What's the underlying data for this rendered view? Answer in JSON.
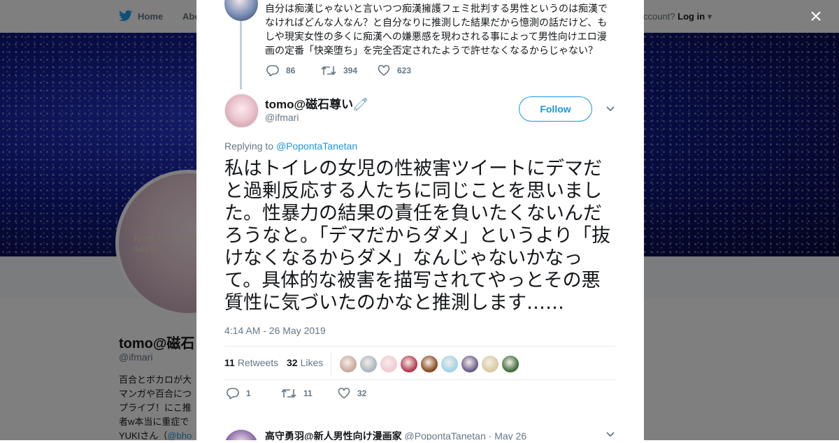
{
  "nav": {
    "home": "Home",
    "about": "Abo",
    "account_prompt": "ccount?",
    "login": "Log in"
  },
  "profile": {
    "name": "tomo@磁石",
    "handle": "@ifmari",
    "avatar_text": "Tomo ちゃん HAPPY BIRTH DAY!!",
    "bio_lines": [
      "百合とボカロが大",
      "マンガや百合につ",
      "プライブ！にこ推",
      "者w本当に重症で",
      "YUKIさん（"
    ],
    "bio_link": "@bho"
  },
  "close_label": "×",
  "previous_tweet": {
    "text": "自分は痴漢じゃないと言いつつ痴漢擁護フェミ批判する男性というのは痴漢でなければどんな人なん？と自分なりに推測した結果だから憶測の話だけど、もしや現実女性の多くに痴漢への嫌悪感を現わされる事によって男性向けエロ漫画の定番「快楽堕ち」を完全否定されたようで許せなくなるからじゃない？",
    "replies": "86",
    "retweets": "394",
    "likes": "623"
  },
  "tweet": {
    "author_name": "tomo@磁石尊い🧷",
    "author_handle": "@ifmari",
    "follow_label": "Follow",
    "replying_prefix": "Replying to",
    "replying_to": "@PopontaTanetan",
    "text": "私はトイレの女児の性被害ツイートにデマだと過剰反応する人たちに同じことを思いました。性暴力の結果の責任を負いたくないんだろうなと。「デマだからダメ」というより「抜けなくなるからダメ」なんじゃないかなって。具体的な被害を描写されてやっとその悪質性に気づいたのかなと推測します……",
    "timestamp": "4:14 AM - 26 May 2019",
    "retweet_count": "11",
    "retweets_label": "Retweets",
    "like_count": "32",
    "likes_label": "Likes",
    "replies": "1",
    "retweets": "11",
    "likes": "32",
    "liker_colors": [
      "#c9a89a",
      "#aab4c0",
      "#f2c9d4",
      "#b23a4e",
      "#8a4a1c",
      "#9fd3e8",
      "#6b5a8e",
      "#d8c9a0",
      "#3f6b3a"
    ]
  },
  "next_tweet": {
    "author_name": "高守勇羽@新人男性向け漫画家",
    "author_handle": "@PopontaTanetan",
    "date": "· May 26"
  },
  "colors": {
    "accent": "#1b95e0",
    "muted": "#657786",
    "text": "#14171a"
  }
}
